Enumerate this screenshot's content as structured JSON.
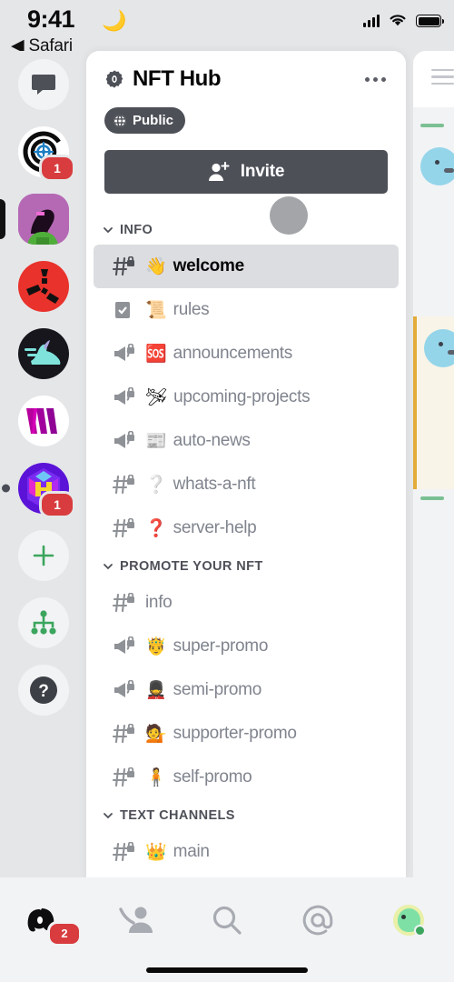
{
  "status_bar": {
    "time": "9:41",
    "moon_icon": "crescent-moon-icon",
    "back_label": "◀ Safari",
    "signal_icon": "cellular-signal-icon",
    "wifi_icon": "wifi-icon",
    "battery_icon": "battery-full-icon"
  },
  "server_rail": {
    "items": [
      {
        "name": "direct-messages",
        "icon": "chat-bubble-icon",
        "badge": "",
        "active": false,
        "shape": "circle"
      },
      {
        "name": "target-server",
        "icon": "target-icon",
        "badge": "1",
        "active": false,
        "shape": "circle"
      },
      {
        "name": "nft-hub-server",
        "icon": "avatar-icon",
        "badge": "",
        "active": true,
        "shape": "squircle"
      },
      {
        "name": "red-server",
        "icon": "logo-icon",
        "badge": "",
        "active": false,
        "shape": "circle"
      },
      {
        "name": "sneaker-server",
        "icon": "sneaker-icon",
        "badge": "",
        "active": false,
        "shape": "circle"
      },
      {
        "name": "w-server",
        "icon": "w-logo-icon",
        "badge": "",
        "active": false,
        "shape": "circle"
      },
      {
        "name": "hex-server",
        "icon": "hexagon-h-icon",
        "badge": "1",
        "active": false,
        "shape": "circle",
        "unread": true
      },
      {
        "name": "add-server",
        "icon": "plus-icon",
        "badge": "",
        "active": false,
        "shape": "circle"
      },
      {
        "name": "explore-servers",
        "icon": "compass-tree-icon",
        "badge": "",
        "active": false,
        "shape": "circle"
      },
      {
        "name": "help",
        "icon": "question-mark-icon",
        "badge": "",
        "active": false,
        "shape": "circle"
      }
    ]
  },
  "panel": {
    "header": {
      "title": "NFT Hub",
      "verified_icon": "verified-badge-icon",
      "more_icon": "more-options-icon"
    },
    "privacy_tag": {
      "label": "Public",
      "icon": "globe-icon"
    },
    "invite_button": {
      "label": "Invite",
      "icon": "add-person-icon"
    },
    "categories": [
      {
        "label": "INFO",
        "channels": [
          {
            "name": "welcome",
            "emoji": "👋",
            "type": "text",
            "locked": true,
            "active": true
          },
          {
            "name": "rules",
            "emoji": "📜",
            "type": "rules",
            "locked": false,
            "active": false
          },
          {
            "name": "announcements",
            "emoji": "🆘",
            "type": "announcement",
            "locked": true,
            "active": false
          },
          {
            "name": "upcoming-projects",
            "emoji": "🛩",
            "type": "announcement",
            "locked": true,
            "active": false
          },
          {
            "name": "auto-news",
            "emoji": "📰",
            "type": "announcement",
            "locked": true,
            "active": false
          },
          {
            "name": "whats-a-nft",
            "emoji": "❔",
            "type": "text",
            "locked": true,
            "active": false
          },
          {
            "name": "server-help",
            "emoji": "❓",
            "type": "text",
            "locked": true,
            "active": false
          }
        ]
      },
      {
        "label": "PROMOTE YOUR NFT",
        "channels": [
          {
            "name": "info",
            "emoji": "",
            "type": "text",
            "locked": true,
            "active": false
          },
          {
            "name": "super-promo",
            "emoji": "🤴",
            "type": "announcement",
            "locked": true,
            "active": false
          },
          {
            "name": "semi-promo",
            "emoji": "💂",
            "type": "announcement",
            "locked": true,
            "active": false
          },
          {
            "name": "supporter-promo",
            "emoji": "💁",
            "type": "text",
            "locked": true,
            "active": false
          },
          {
            "name": "self-promo",
            "emoji": "🧍",
            "type": "text",
            "locked": true,
            "active": false
          }
        ]
      },
      {
        "label": "TEXT CHANNELS",
        "channels": [
          {
            "name": "main",
            "emoji": "👑",
            "type": "text",
            "locked": true,
            "active": false
          }
        ]
      }
    ]
  },
  "tab_bar": {
    "tabs": [
      {
        "name": "servers",
        "icon": "discord-logo-icon",
        "badge": "2",
        "active": true
      },
      {
        "name": "friends",
        "icon": "friends-icon",
        "badge": "",
        "active": false
      },
      {
        "name": "search",
        "icon": "search-icon",
        "badge": "",
        "active": false
      },
      {
        "name": "mentions",
        "icon": "at-mention-icon",
        "badge": "",
        "active": false
      },
      {
        "name": "profile",
        "icon": "user-avatar-icon",
        "badge": "",
        "active": false
      }
    ]
  },
  "colors": {
    "accent_red": "#d83c3e",
    "dark_button": "#4e5058",
    "online_green": "#3ba55d",
    "background": "#e5e6e8",
    "panel": "#ffffff"
  }
}
